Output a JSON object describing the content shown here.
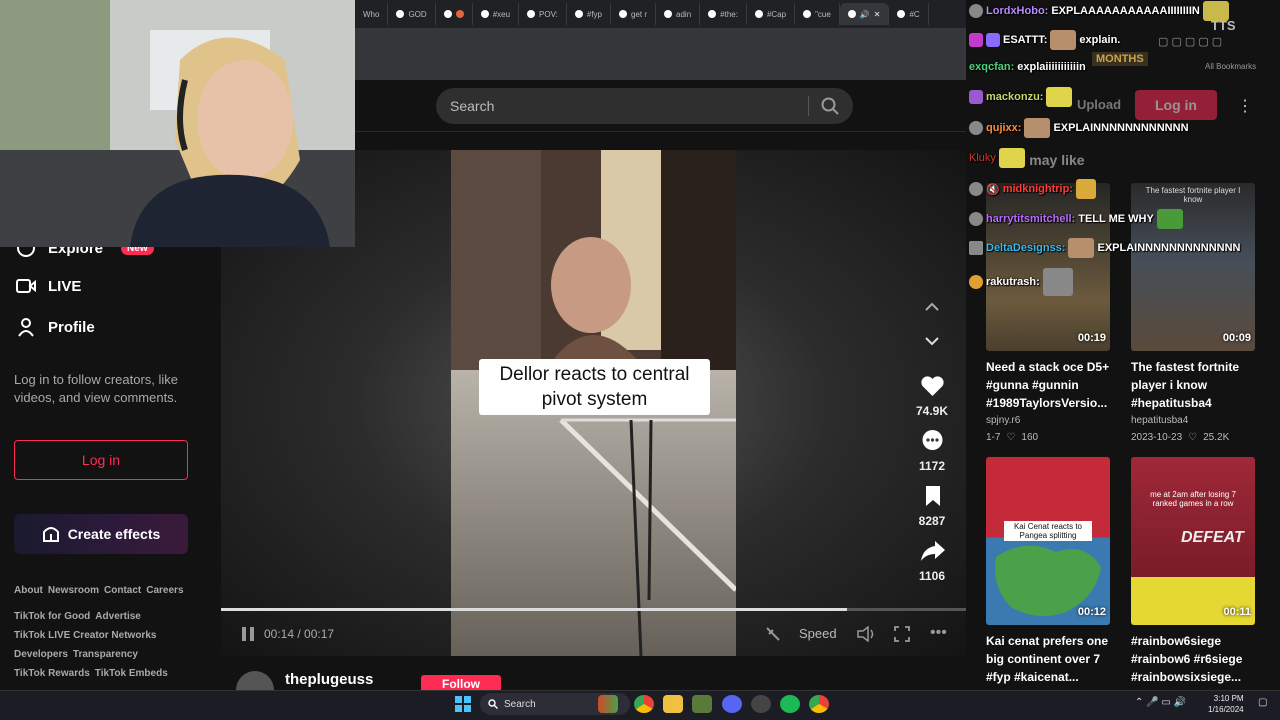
{
  "browser": {
    "tabs": [
      "Who",
      "GOD",
      "",
      "#xeu",
      "POV:",
      "#fyp",
      "get r",
      "adin",
      "#the:",
      "#Cap",
      "\"cue",
      "",
      "#C"
    ],
    "all_bookmarks": "All Bookmarks"
  },
  "header": {
    "search_placeholder": "Search",
    "upload_label": "Upload",
    "login_label": "Log in"
  },
  "sidebar": {
    "items": [
      {
        "label": "Explore",
        "badge": "New",
        "icon": "compass-icon"
      },
      {
        "label": "LIVE",
        "icon": "live-icon"
      },
      {
        "label": "Profile",
        "icon": "person-icon"
      }
    ],
    "login_note": "Log in to follow creators, like videos, and view comments.",
    "login_button": "Log in",
    "create_effects": "Create effects",
    "footer_rows": [
      [
        "About",
        "Newsroom",
        "Contact",
        "Careers"
      ],
      [
        "TikTok for Good",
        "Advertise"
      ],
      [
        "TikTok LIVE Creator Networks"
      ],
      [
        "Developers",
        "Transparency"
      ],
      [
        "TikTok Rewards",
        "TikTok Embeds"
      ]
    ]
  },
  "video": {
    "caption": "Dellor reacts to central pivot system",
    "time": "00:14 / 00:17",
    "progress_fraction": 0.84,
    "speed_label": "Speed",
    "likes": "74.9K",
    "comments": "1172",
    "bookmarks": "8287",
    "shares": "1106",
    "author": "theplugeuss",
    "follow_label": "Follow"
  },
  "right": {
    "section_title": "You may like",
    "videos": [
      {
        "title": "Need a stack oce D5+ #gunna #gunnin #1989TaylorsVersio...",
        "author": "spjny.r6",
        "date": "1-7",
        "likes": "160",
        "duration": "00:19",
        "thumb_text": ""
      },
      {
        "title": "The fastest fortnite player i know #hepatitusba4",
        "author": "hepatitusba4",
        "date": "2023-10-23",
        "likes": "25.2K",
        "duration": "00:09",
        "thumb_text": "The fastest fortnite player I know"
      },
      {
        "title": "Kai cenat prefers one big continent over 7 #fyp #kaicenat...",
        "author": "",
        "date": "",
        "likes": "",
        "duration": "00:12",
        "thumb_text": "Kai Cenat reacts to Pangea splitting"
      },
      {
        "title": "#rainbow6siege #rainbow6 #r6siege #rainbowsixsiege...",
        "author": "",
        "date": "",
        "likes": "",
        "duration": "00:11",
        "thumb_text": "me at 2am after losing 7 ranked games in a row",
        "thumb_big": "DEFEAT"
      }
    ]
  },
  "chat": [
    {
      "user": "LordxHobo:",
      "msg": "EXPLAAAAAAAAAAAIIIIIIIIN",
      "color": "#b98aff"
    },
    {
      "user": "ESATTT:",
      "msg": "explain.",
      "color": "#ffffff"
    },
    {
      "user": "exqcfan:",
      "msg": "explaiiiiiiiiiiin",
      "color": "#4fd17a"
    },
    {
      "user": "mackonzu:",
      "msg": "",
      "color": "#c7d66b"
    },
    {
      "user": "qujixx:",
      "msg": "EXPLAINNNNNNNNNNNN",
      "color": "#ff8c3a"
    },
    {
      "user": "Kluky",
      "msg": "",
      "color": "#d9342b"
    },
    {
      "user": "midknightrip:",
      "msg": "",
      "color": "#ff3b3b"
    },
    {
      "user": "harrytitsmitchell:",
      "msg": "TELL ME WHY",
      "color": "#b66bff"
    },
    {
      "user": "DeltaDesignss:",
      "msg": "EXPLAINNNNNNNNNNNNN",
      "color": "#3fb7e8"
    },
    {
      "user": "rakutrash:",
      "msg": "",
      "color": "#e0e0e0"
    }
  ],
  "stream_overlay": {
    "tts": "TTS",
    "months_label": "MONTHS"
  },
  "taskbar": {
    "search_label": "Search",
    "time": "3:10 PM",
    "date": "1/16/2024"
  }
}
